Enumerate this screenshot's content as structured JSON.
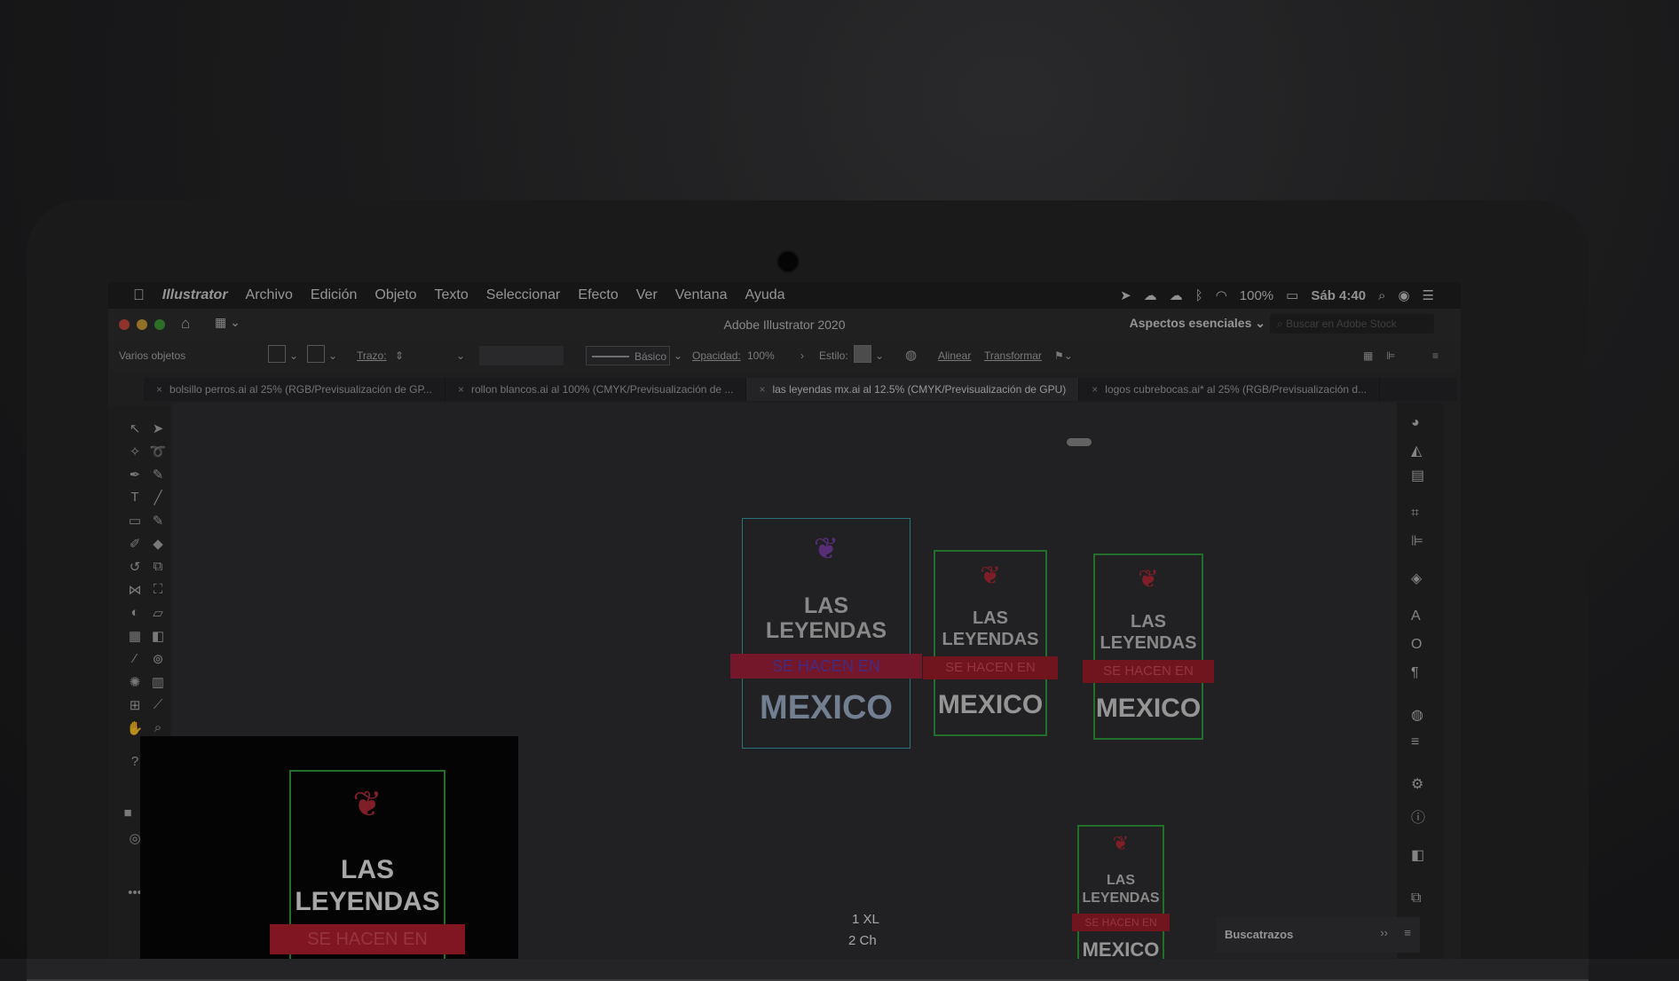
{
  "menubar": {
    "apple": "",
    "items": [
      "Illustrator",
      "Archivo",
      "Edición",
      "Objeto",
      "Texto",
      "Seleccionar",
      "Efecto",
      "Ver",
      "Ventana",
      "Ayuda"
    ],
    "battery": "100%",
    "clock": "Sáb 4:40"
  },
  "window": {
    "title": "Adobe Illustrator 2020",
    "workspace": "Aspectos esenciales",
    "stock_search_placeholder": "Buscar en Adobe Stock"
  },
  "controlbar": {
    "selection": "Varios objetos",
    "stroke_label": "Trazo:",
    "brush": "Básico",
    "opacity_label": "Opacidad:",
    "opacity_value": "100%",
    "style_label": "Estilo:",
    "align": "Alinear",
    "transform": "Transformar"
  },
  "tabs": [
    {
      "label": "bolsillo perros.ai al 25% (RGB/Previsualización de GP..."
    },
    {
      "label": "rollon blancos.ai al 100% (CMYK/Previsualización de ..."
    },
    {
      "label": "las leyendas mx.ai al 12.5% (CMYK/Previsualización de GPU)"
    },
    {
      "label": "logos cubrebocas.ai* al 25% (RGB/Previsualización d..."
    }
  ],
  "artwork": {
    "line1": "LAS",
    "line2": "LEYENDAS",
    "banner": "SE HACEN EN",
    "bottom": "MEXICO"
  },
  "canvas_notes": [
    "1 XL",
    "2 Ch"
  ],
  "panels": {
    "pathfinder": "Buscatrazos"
  },
  "icons": {
    "apple": "apple-icon",
    "search": "search-icon",
    "wifi": "wifi-icon",
    "home": "home-icon"
  }
}
